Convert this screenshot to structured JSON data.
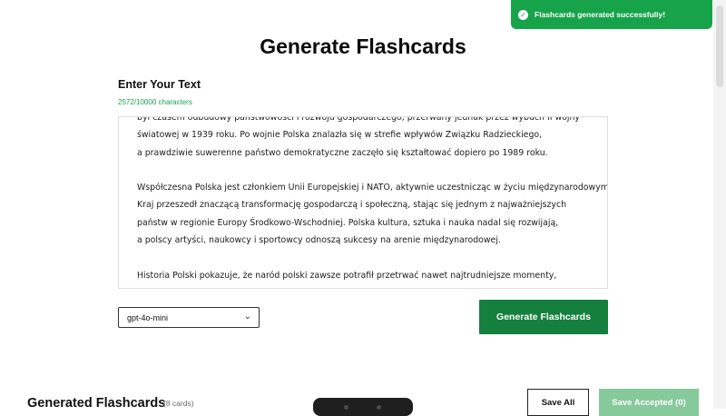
{
  "toast": {
    "message": "Flashcards generated successfully!",
    "icon": "check-circle-icon",
    "color": "#16a34a"
  },
  "page": {
    "title": "Generate Flashcards"
  },
  "input": {
    "label": "Enter Your Text",
    "char_count": "2572/10000 characters",
    "text": "był czasem odbudowy państwowości i rozwoju gospodarczego, przerwany jednak przez wybuch II wojny\nświatowej w 1939 roku. Po wojnie Polska znalazła się w strefie wpływów Związku Radzieckiego,\na prawdziwie suwerenne państwo demokratyczne zaczęło się kształtować dopiero po 1989 roku.\n\nWspółczesna Polska jest członkiem Unii Europejskiej i NATO, aktywnie uczestnicząc w życiu międzynarodowym.\nKraj przeszedł znaczącą transformację gospodarczą i społeczną, stając się jednym z najważniejszych\npaństw w regionie Europy Środkowo-Wschodniej. Polska kultura, sztuka i nauka nadal się rozwijają,\na polscy artyści, naukowcy i sportowcy odnoszą sukcesy na arenie międzynarodowej.\n\nHistoria Polski pokazuje, że naród polski zawsze potrafił przetrwać nawet najtrudniejsze momenty,\nzachowując swoją tożsamość i kulturę. Ta resilience i determinacja są widoczne również dzisiaj,\ngdy Polska stawia czoła nowym wyzwaniom XXI wieku."
  },
  "model_select": {
    "value": "gpt-4o-mini",
    "icon": "chevron-down-icon"
  },
  "buttons": {
    "generate": "Generate Flashcards",
    "save_all": "Save All",
    "save_accepted": "Save Accepted (0)"
  },
  "results": {
    "title": "Generated Flashcards",
    "count": "(8 cards)"
  },
  "colors": {
    "primary": "#15803d",
    "primary_disabled": "#86c99b",
    "success": "#16a34a"
  }
}
